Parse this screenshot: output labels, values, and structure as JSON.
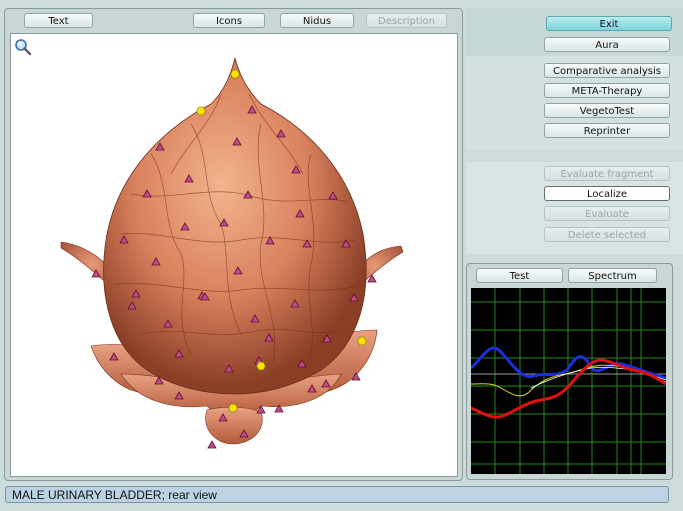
{
  "top_tabs": [
    {
      "label": "Text",
      "enabled": true
    },
    {
      "label": "Icons",
      "enabled": true
    },
    {
      "label": "Nidus",
      "enabled": true
    },
    {
      "label": "Description",
      "enabled": false
    }
  ],
  "right_menu": {
    "exit": "Exit",
    "aura": "Aura",
    "group1": [
      "Comparative analysis",
      "META-Therapy",
      "VegetoTest",
      "Reprinter"
    ],
    "group2": [
      {
        "label": "Evaluate fragment",
        "enabled": false
      },
      {
        "label": "Localize",
        "enabled": true
      },
      {
        "label": "Evaluate",
        "enabled": false
      },
      {
        "label": "Delete selected",
        "enabled": false
      }
    ]
  },
  "graph_tabs": {
    "test": "Test",
    "spectrum": "Spectrum"
  },
  "status_text": "MALE URINARY BLADDER; rear view",
  "icons": {
    "zoom": "magnifier-icon"
  },
  "colors": {
    "background": "#ccdcdc",
    "status_bar": "#bcd3e3",
    "exit_button": "#7fd3da",
    "graph_bg": "#000000",
    "graph_grid": "#1f8a1f",
    "series_blue": "#1b2fe0",
    "series_red": "#e01010",
    "series_yellow": "#d8d820",
    "series_white": "#ffffff",
    "marker_triangle": "#c44a8a",
    "marker_hexagon": "#f5e400"
  }
}
